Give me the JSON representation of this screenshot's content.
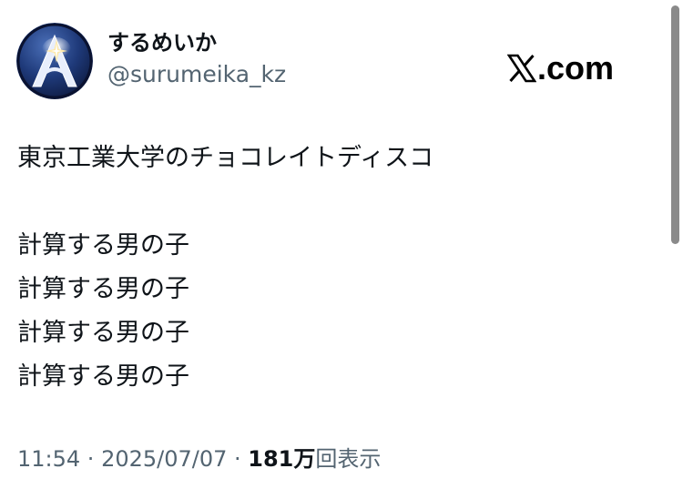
{
  "user": {
    "display_name": "するめいか",
    "handle": "@surumeika_kz"
  },
  "brand": {
    "site": ".com",
    "logo_icon": "x-logo-icon"
  },
  "tweet": {
    "lines": [
      "東京工業大学のチョコレイトディスコ",
      "",
      "計算する男の子",
      "計算する男の子",
      "計算する男の子",
      "計算する男の子"
    ]
  },
  "meta": {
    "time": "11:54",
    "separator": " · ",
    "date": "2025/07/07",
    "views_count": "181万",
    "views_label": "回表示"
  },
  "colors": {
    "text": "#0f1419",
    "secondary": "#536471",
    "avatar_bg": "#1b2f66"
  },
  "icons": {
    "avatar": "star-emblem-avatar"
  }
}
